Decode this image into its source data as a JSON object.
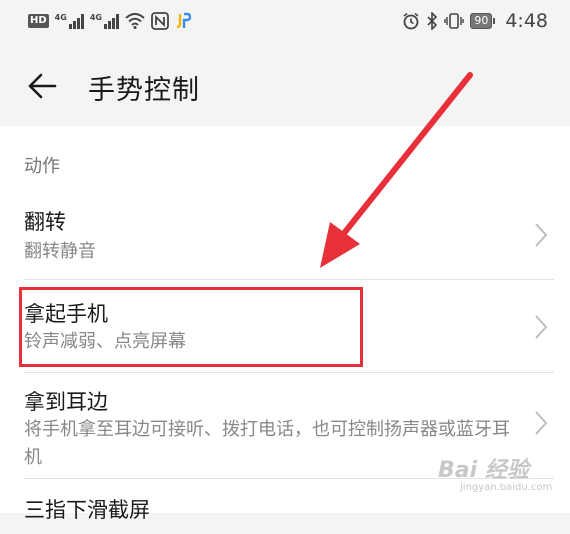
{
  "status_bar": {
    "hd": "HD",
    "net1": "4G",
    "net2": "4G",
    "battery": "90",
    "time": "4:48"
  },
  "header": {
    "title": "手势控制"
  },
  "section": {
    "label": "动作"
  },
  "items": [
    {
      "title": "翻转",
      "subtitle": "翻转静音"
    },
    {
      "title": "拿起手机",
      "subtitle": "铃声减弱、点亮屏幕"
    },
    {
      "title": "拿到耳边",
      "subtitle": "将手机拿至耳边可接听、拨打电话，也可控制扬声器或蓝牙耳机"
    },
    {
      "title": "三指下滑截屏",
      "subtitle": ""
    }
  ],
  "watermark": {
    "main": "Bai 经验",
    "sub": "jingyan.baidu.com"
  },
  "colors": {
    "highlight": "#e8303a",
    "background": "#f4f4f4"
  }
}
